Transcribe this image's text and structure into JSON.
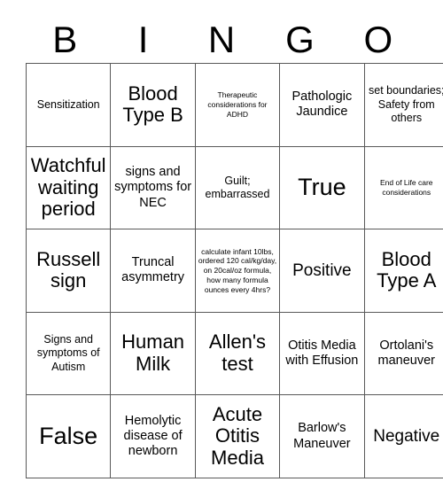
{
  "card": {
    "header_letters": [
      "B",
      "I",
      "N",
      "G",
      "O"
    ],
    "rows": [
      [
        {
          "text": "Sensitization",
          "size": "fs-sm"
        },
        {
          "text": "Blood Type B",
          "size": "fs-xl"
        },
        {
          "text": "Therapeutic considerations for ADHD",
          "size": "fs-xs"
        },
        {
          "text": "Pathologic Jaundice",
          "size": "fs-md"
        },
        {
          "text": "set boundaries; Safety from others",
          "size": "fs-sm"
        }
      ],
      [
        {
          "text": "Watchful waiting period",
          "size": "fs-xl"
        },
        {
          "text": "signs and symptoms for NEC",
          "size": "fs-md"
        },
        {
          "text": "Guilt; embarrassed",
          "size": "fs-sm"
        },
        {
          "text": "True",
          "size": "fs-xxl"
        },
        {
          "text": "End of Life care considerations",
          "size": "fs-xs"
        }
      ],
      [
        {
          "text": "Russell sign",
          "size": "fs-xl"
        },
        {
          "text": "Truncal asymmetry",
          "size": "fs-md"
        },
        {
          "text": "calculate infant 10lbs, ordered 120 cal/kg/day, on 20cal/oz formula, how many formula ounces every 4hrs?",
          "size": "fs-xs"
        },
        {
          "text": "Positive",
          "size": "fs-lg"
        },
        {
          "text": "Blood Type A",
          "size": "fs-xl"
        }
      ],
      [
        {
          "text": "Signs and symptoms of Autism",
          "size": "fs-sm"
        },
        {
          "text": "Human Milk",
          "size": "fs-xl"
        },
        {
          "text": "Allen's test",
          "size": "fs-xl"
        },
        {
          "text": "Otitis Media with Effusion",
          "size": "fs-md"
        },
        {
          "text": "Ortolani's maneuver",
          "size": "fs-md"
        }
      ],
      [
        {
          "text": "False",
          "size": "fs-xxl"
        },
        {
          "text": "Hemolytic disease of newborn",
          "size": "fs-md"
        },
        {
          "text": "Acute Otitis Media",
          "size": "fs-xl"
        },
        {
          "text": "Barlow's Maneuver",
          "size": "fs-md"
        },
        {
          "text": "Negative",
          "size": "fs-lg"
        }
      ]
    ]
  }
}
